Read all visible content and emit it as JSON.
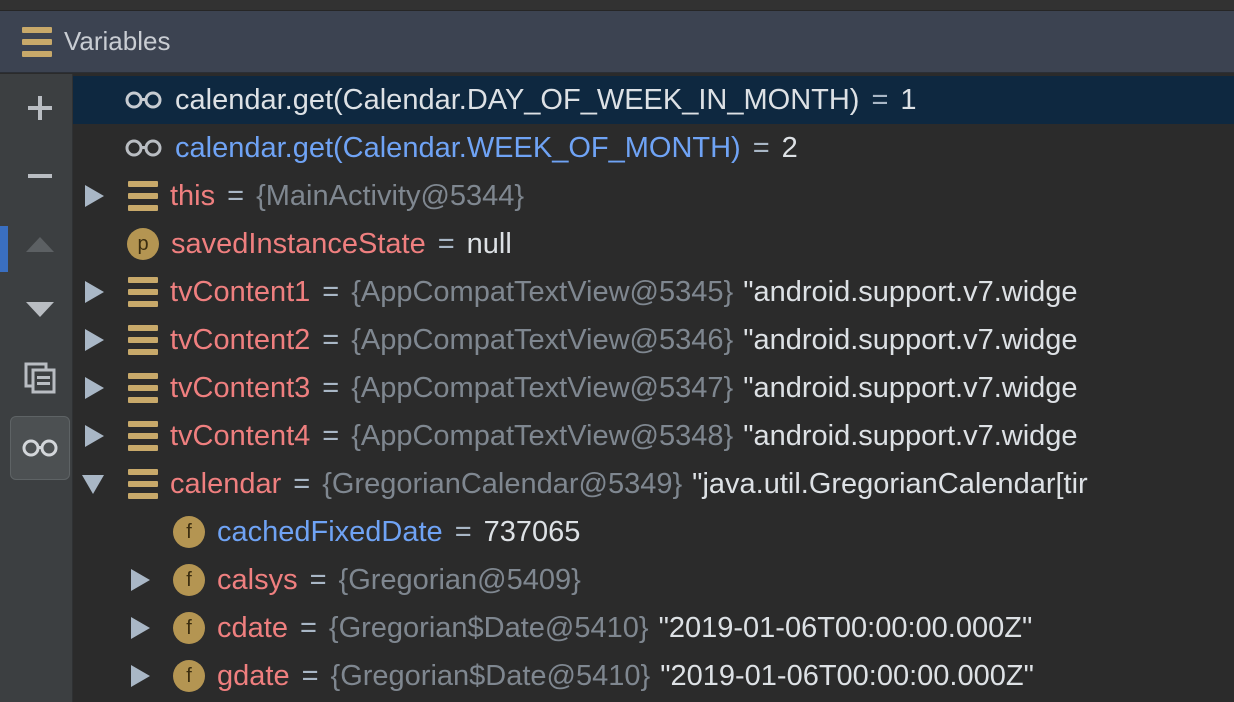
{
  "panel": {
    "title": "Variables",
    "icon": "variables-icon"
  },
  "toolbar": {
    "buttons": [
      {
        "name": "add-watch-button",
        "glyph": "+"
      },
      {
        "name": "remove-watch-button",
        "glyph": "−"
      },
      {
        "name": "move-up-button",
        "glyph": "up"
      },
      {
        "name": "move-down-button",
        "glyph": "down"
      },
      {
        "name": "copy-button",
        "glyph": "copy"
      },
      {
        "name": "show-watches-button",
        "glyph": "glasses"
      }
    ]
  },
  "rows": [
    {
      "kind": "watch",
      "name": "calendar.get(Calendar.DAY_OF_WEEK_IN_MONTH)",
      "name_color": "white",
      "eq": "=",
      "value": "1",
      "selected": true
    },
    {
      "kind": "watch",
      "name": "calendar.get(Calendar.WEEK_OF_MONTH)",
      "name_color": "blue",
      "eq": "=",
      "value": "2"
    },
    {
      "kind": "object",
      "arrow": "right",
      "name": "this",
      "eq": "=",
      "type": "{MainActivity@5344}",
      "value": ""
    },
    {
      "kind": "param",
      "icon_letter": "p",
      "name": "savedInstanceState",
      "eq": "=",
      "value": "null"
    },
    {
      "kind": "object",
      "arrow": "right",
      "name": "tvContent1",
      "eq": "=",
      "type": "{AppCompatTextView@5345}",
      "value": "\"android.support.v7.widge"
    },
    {
      "kind": "object",
      "arrow": "right",
      "name": "tvContent2",
      "eq": "=",
      "type": "{AppCompatTextView@5346}",
      "value": "\"android.support.v7.widge"
    },
    {
      "kind": "object",
      "arrow": "right",
      "name": "tvContent3",
      "eq": "=",
      "type": "{AppCompatTextView@5347}",
      "value": "\"android.support.v7.widge"
    },
    {
      "kind": "object",
      "arrow": "right",
      "name": "tvContent4",
      "eq": "=",
      "type": "{AppCompatTextView@5348}",
      "value": "\"android.support.v7.widge"
    },
    {
      "kind": "object",
      "arrow": "down",
      "name": "calendar",
      "eq": "=",
      "type": "{GregorianCalendar@5349}",
      "value": "\"java.util.GregorianCalendar[tir"
    },
    {
      "kind": "field",
      "child": true,
      "icon_letter": "f",
      "name": "cachedFixedDate",
      "name_color": "blue",
      "eq": "=",
      "value": "737065"
    },
    {
      "kind": "field",
      "child": true,
      "arrow": "right",
      "icon_letter": "f",
      "name": "calsys",
      "eq": "=",
      "type": "{Gregorian@5409}",
      "value": ""
    },
    {
      "kind": "field",
      "child": true,
      "arrow": "right",
      "icon_letter": "f",
      "name": "cdate",
      "eq": "=",
      "type": "{Gregorian$Date@5410}",
      "value": "\"2019-01-06T00:00:00.000Z\""
    },
    {
      "kind": "field",
      "child": true,
      "arrow": "right",
      "icon_letter": "f",
      "name": "gdate",
      "eq": "=",
      "type": "{Gregorian$Date@5410}",
      "value": "\"2019-01-06T00:00:00.000Z\""
    }
  ],
  "colors": {
    "selected_bg": "#0e2840",
    "name_red": "#ef7f7f",
    "name_blue": "#6fa3f5",
    "type_gray": "#7f8790",
    "icon_gold": "#c8a96a"
  }
}
